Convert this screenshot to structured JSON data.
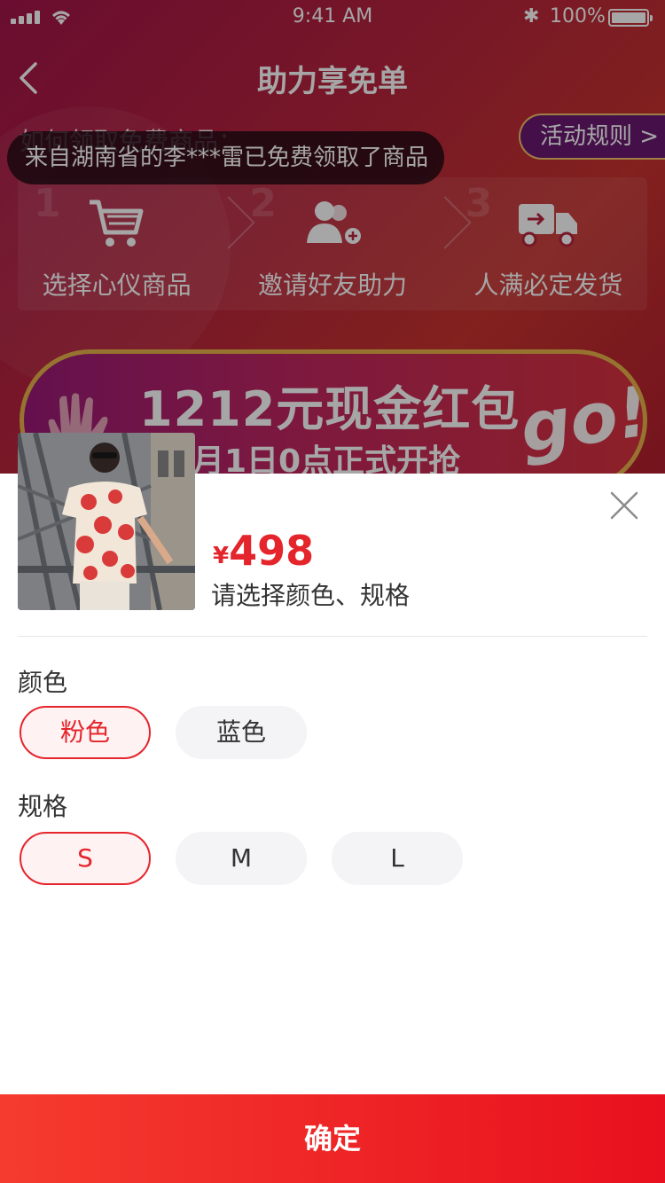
{
  "status_bar": {
    "time": "9:41 AM",
    "battery": "100%"
  },
  "background_page": {
    "title": "助力享免单",
    "how_to_title": "如何领取免费商品：",
    "rules_label": "活动规则 >",
    "steps": [
      {
        "label": "选择心仪商品",
        "icon": "shopping-cart-icon"
      },
      {
        "label": "邀请好友助力",
        "icon": "invite-friends-icon"
      },
      {
        "label": "人满必定发货",
        "icon": "delivery-truck-icon"
      }
    ],
    "banner": {
      "headline": "1212元现金红包",
      "subline": "月1日0点正式开抢",
      "go": "go!"
    }
  },
  "toast": "来自湖南省的李***雷已免费领取了商品",
  "product": {
    "currency": "¥",
    "price": "498",
    "hint": "请选择颜色、规格"
  },
  "options": {
    "color": {
      "title": "颜色",
      "items": [
        "粉色",
        "蓝色"
      ],
      "selected": 0
    },
    "size": {
      "title": "规格",
      "items": [
        "S",
        "M",
        "L"
      ],
      "selected": 0
    }
  },
  "confirm_label": "确定",
  "colors": {
    "accent": "#e4252c",
    "chip_bg": "#f4f3f5",
    "selected_chip_bg": "#fff2f3"
  }
}
